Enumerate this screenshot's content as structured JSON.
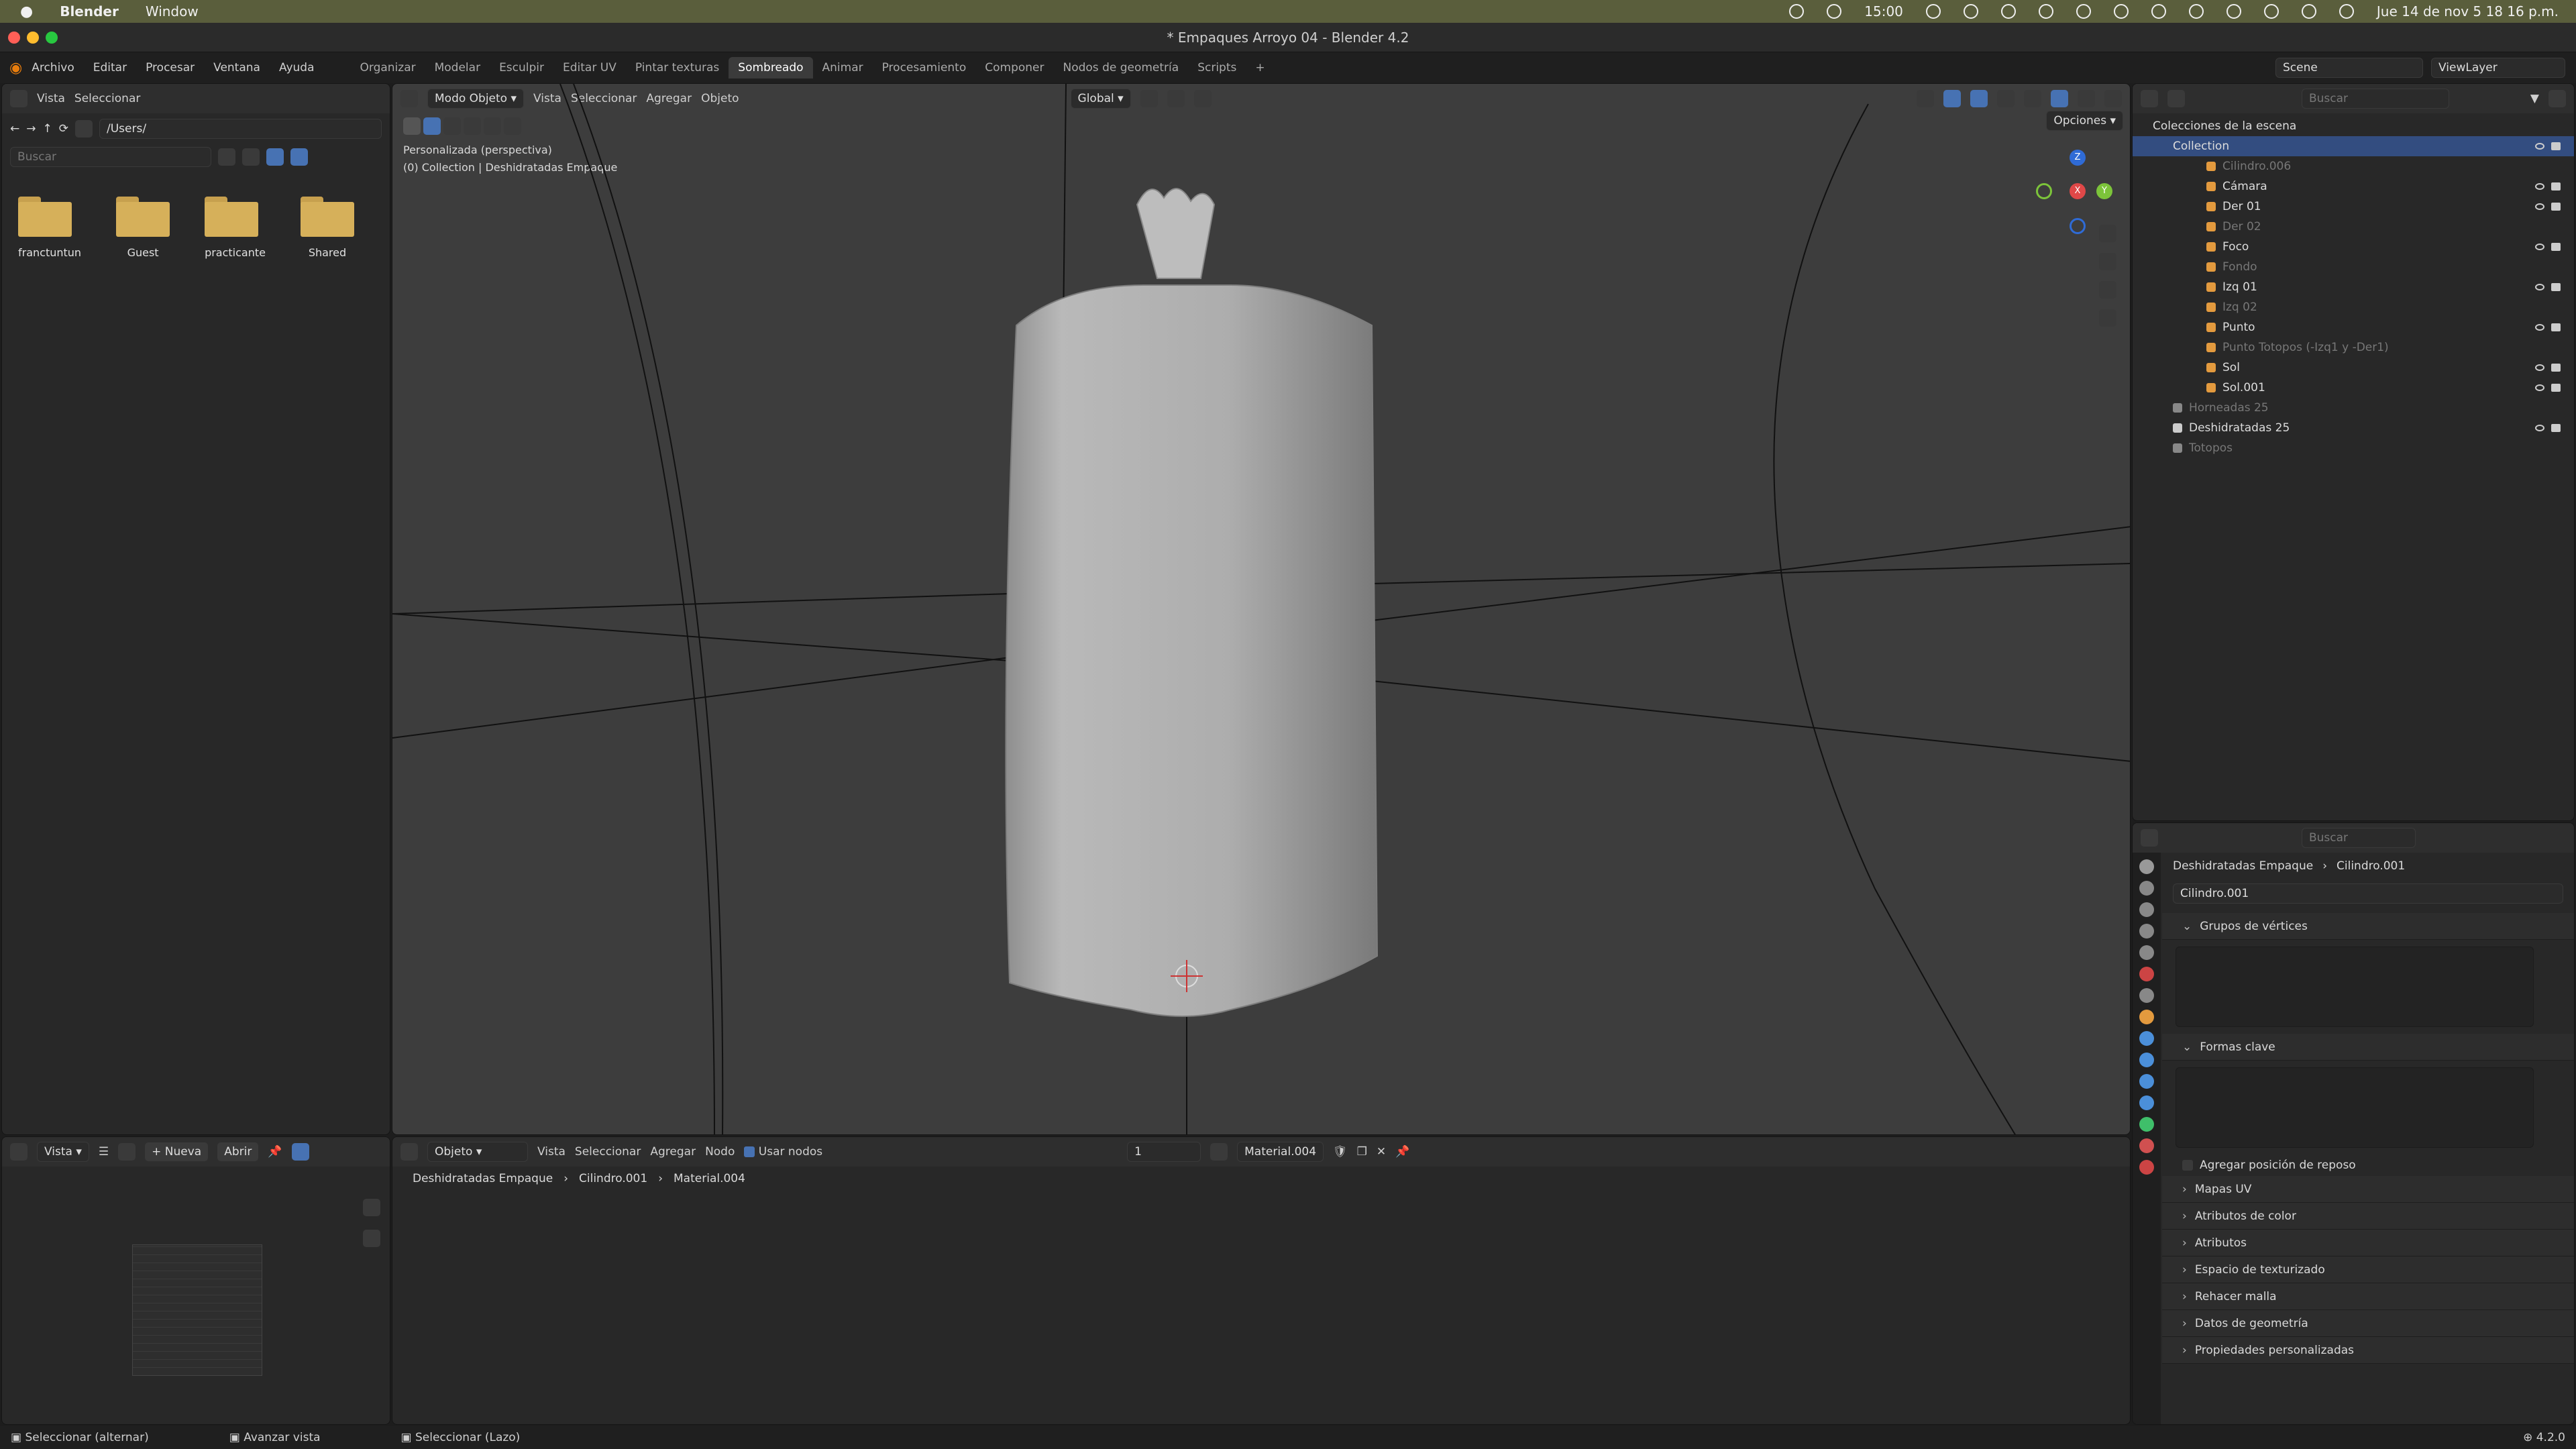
{
  "mac_bar": {
    "app": "Blender",
    "menus": [
      "Window"
    ],
    "time_center": "15:00",
    "datetime": "Jue 14 de nov  5 18 16 p.m."
  },
  "window": {
    "title": "* Empaques Arroyo 04 - Blender 4.2"
  },
  "menubar": {
    "menus": [
      "Archivo",
      "Editar",
      "Procesar",
      "Ventana",
      "Ayuda"
    ],
    "workspaces": [
      "Organizar",
      "Modelar",
      "Esculpir",
      "Editar UV",
      "Pintar texturas",
      "Sombreado",
      "Animar",
      "Procesamiento",
      "Componer",
      "Nodos de geometría",
      "Scripts"
    ],
    "active_workspace": "Sombreado",
    "scene": "Scene",
    "view_layer": "ViewLayer"
  },
  "file_browser": {
    "menus": [
      "Vista",
      "Seleccionar"
    ],
    "path": "/Users/",
    "search_placeholder": "Buscar",
    "folders": [
      "franctuntun",
      "Guest",
      "practicante",
      "Shared"
    ]
  },
  "image_editor": {
    "view_label": "Vista",
    "new_label": "Nueva",
    "open_label": "Abrir"
  },
  "viewport": {
    "mode": "Modo Objeto",
    "menus": [
      "Vista",
      "Seleccionar",
      "Agregar",
      "Objeto"
    ],
    "transform": "Global",
    "options": "Opciones",
    "info_line1": "Personalizada (perspectiva)",
    "info_line2": "(0) Collection | Deshidratadas Empaque",
    "axis_x": "X",
    "axis_y": "Y",
    "axis_z": "Z"
  },
  "shader_editor": {
    "object_mode": "Objeto",
    "menus": [
      "Vista",
      "Seleccionar",
      "Agregar",
      "Nodo"
    ],
    "use_nodes": "Usar nodos",
    "slot": "1",
    "material": "Material.004",
    "breadcrumb": [
      "Deshidratadas Empaque",
      "Cilindro.001",
      "Material.004"
    ]
  },
  "outliner": {
    "search_placeholder": "Buscar",
    "root": "Colecciones de la escena",
    "collection": "Collection",
    "items": [
      {
        "name": "Cilindro.006",
        "dim": true
      },
      {
        "name": "Cámara",
        "dim": false
      },
      {
        "name": "Der 01",
        "dim": false
      },
      {
        "name": "Der 02",
        "dim": true
      },
      {
        "name": "Foco",
        "dim": false
      },
      {
        "name": "Fondo",
        "dim": true
      },
      {
        "name": "Izq 01",
        "dim": false
      },
      {
        "name": "Izq 02",
        "dim": true
      },
      {
        "name": "Punto",
        "dim": false
      },
      {
        "name": "Punto Totopos (-Izq1 y -Der1)",
        "dim": true
      },
      {
        "name": "Sol",
        "dim": false
      },
      {
        "name": "Sol.001",
        "dim": false
      }
    ],
    "sub_collections": [
      {
        "name": "Horneadas 25",
        "dim": true
      },
      {
        "name": "Deshidratadas 25",
        "dim": false
      },
      {
        "name": "Totopos",
        "dim": true
      }
    ]
  },
  "properties": {
    "search_placeholder": "Buscar",
    "breadcrumb_object": "Deshidratadas Empaque",
    "breadcrumb_data": "Cilindro.001",
    "mesh_name": "Cilindro.001",
    "vertex_groups": "Grupos de vértices",
    "shape_keys": "Formas clave",
    "add_rest_position": "Agregar posición de reposo",
    "sections": [
      "Mapas UV",
      "Atributos de color",
      "Atributos",
      "Espacio de texturizado",
      "Rehacer malla",
      "Datos de geometría",
      "Propiedades personalizadas"
    ]
  },
  "status_bar": {
    "left": "Seleccionar (alternar)",
    "middle": "Avanzar vista",
    "right": "Seleccionar (Lazo)",
    "version": "4.2.0"
  },
  "colors": {
    "accent_blue": "#4772b3",
    "selected_row": "#334d80",
    "object_orange": "#e39a3e",
    "folder": "#d6b05a"
  }
}
